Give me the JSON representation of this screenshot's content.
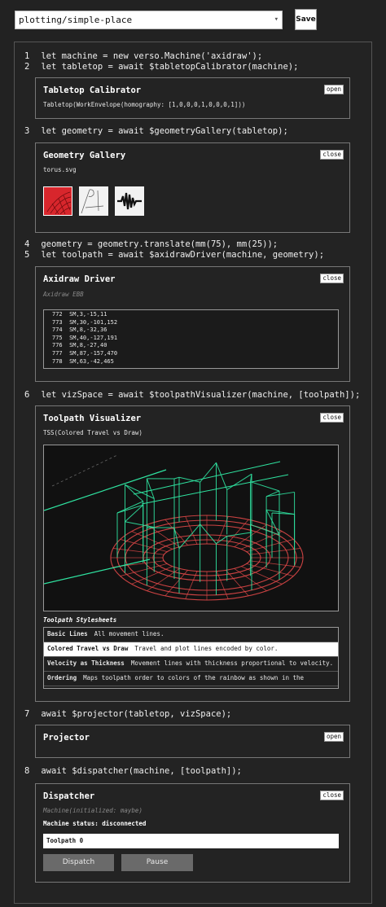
{
  "header": {
    "file_select": "plotting/simple-place",
    "save_label": "Save"
  },
  "code_lines": [
    {
      "n": "1",
      "text": "let machine = new verso.Machine('axidraw');"
    },
    {
      "n": "2",
      "text": "let tabletop = await $tabletopCalibrator(machine);"
    },
    {
      "n": "3",
      "text": "let geometry = await $geometryGallery(tabletop);"
    },
    {
      "n": "4",
      "text": "geometry = geometry.translate(mm(75), mm(25));"
    },
    {
      "n": "5",
      "text": "let toolpath = await $axidrawDriver(machine, geometry);"
    },
    {
      "n": "6",
      "text": "let vizSpace = await $toolpathVisualizer(machine, [toolpath]);"
    },
    {
      "n": "7",
      "text": "await $projector(tabletop, vizSpace);"
    },
    {
      "n": "8",
      "text": "await $dispatcher(machine, [toolpath]);"
    }
  ],
  "cells": {
    "tabletop": {
      "title": "Tabletop Calibrator",
      "toggle": "open",
      "body": "Tabletop(WorkEnvelope(homography: [1,0,0,0,1,0,0,0,1]))"
    },
    "gallery": {
      "title": "Geometry Gallery",
      "toggle": "close",
      "file": "torus.svg"
    },
    "driver": {
      "title": "Axidraw Driver",
      "toggle": "close",
      "subtitle": "Axidraw EBB",
      "log": [
        "772  SM,3,-15,11",
        "773  SM,30,-101,152",
        "774  SM,8,-32,36",
        "775  SM,40,-127,191",
        "776  SM,8,-27,40",
        "777  SM,87,-157,470",
        "778  SM,63,-42,465"
      ]
    },
    "visualizer": {
      "title": "Toolpath Visualizer",
      "toggle": "close",
      "subtitle": "TSS(Colored Travel vs Draw)",
      "sheets_title": "Toolpath Stylesheets",
      "sheets": [
        {
          "name": "Basic Lines",
          "desc": "All movement lines."
        },
        {
          "name": "Colored Travel vs Draw",
          "desc": "Travel and plot lines encoded by color."
        },
        {
          "name": "Velocity as Thickness",
          "desc": "Movement lines with thickness proportional to velocity."
        },
        {
          "name": "Ordering",
          "desc": "Maps toolpath order to colors of the rainbow as shown in the"
        }
      ]
    },
    "projector": {
      "title": "Projector",
      "toggle": "open"
    },
    "dispatcher": {
      "title": "Dispatcher",
      "toggle": "close",
      "subtitle": "Machine(initialized: maybe)",
      "status": "Machine status: disconnected",
      "toolpath": "Toolpath 0",
      "dispatch_label": "Dispatch",
      "pause_label": "Pause"
    }
  },
  "colors": {
    "travel_line": "#2fe3a0",
    "draw_line": "#e04848",
    "thumb_red": "#d8262c"
  }
}
